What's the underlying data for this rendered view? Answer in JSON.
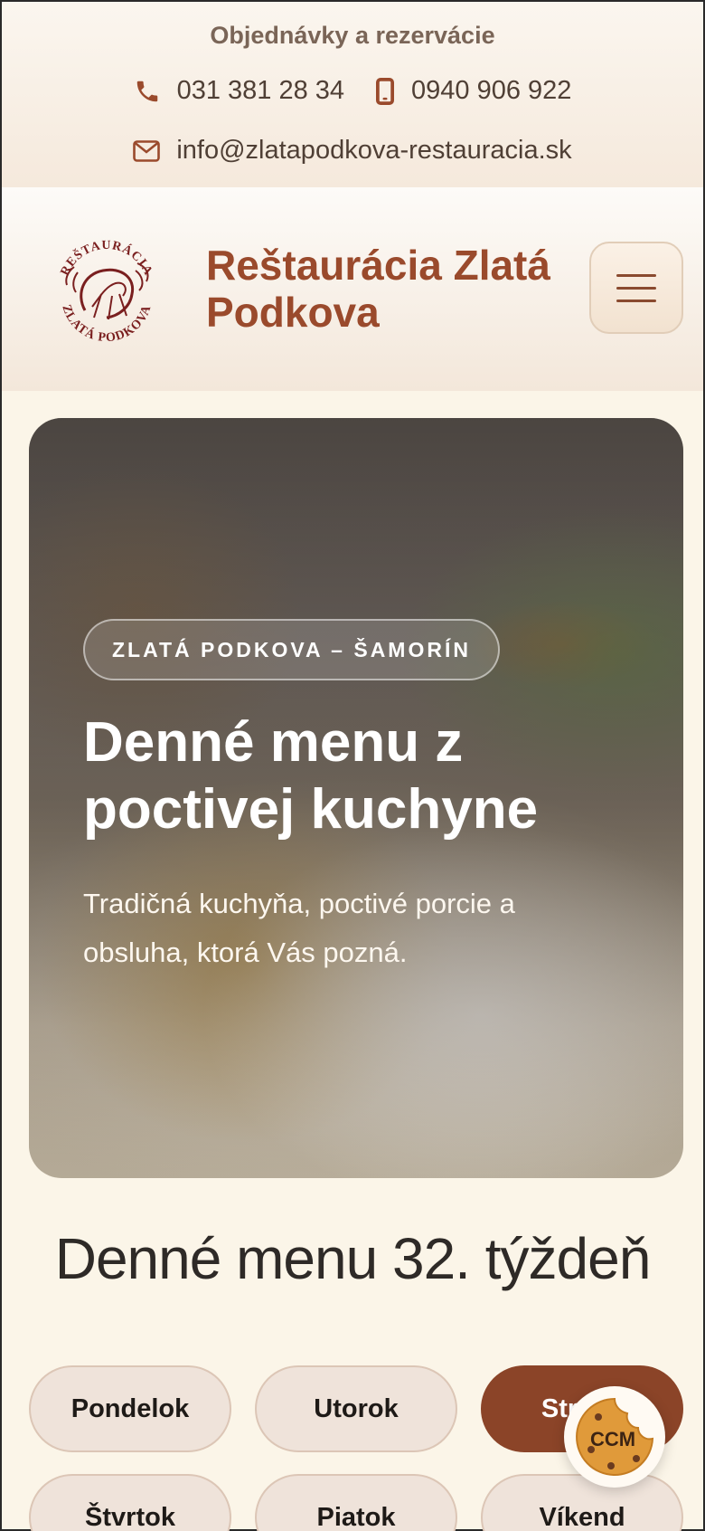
{
  "topbar": {
    "title": "Objednávky a rezervácie",
    "phone": "031 381 28 34",
    "mobile": "0940 906 922",
    "email": "info@zlatapodkova-restauracia.sk"
  },
  "header": {
    "brand": "Reštaurácia Zlatá Podkova",
    "logo_text_top": "REŠTAURÁCIA",
    "logo_text_bottom": "ZLATÁ PODKOVA"
  },
  "hero": {
    "badge": "ZLATÁ PODKOVA – ŠAMORÍN",
    "title": "Denné menu z poctivej kuchyne",
    "subtitle": "Tradičná kuchyňa, poctivé porcie a obsluha, ktorá Vás pozná."
  },
  "menu": {
    "heading": "Denné menu 32. týždeň",
    "days": [
      "Pondelok",
      "Utorok",
      "Streda",
      "Štvrtok",
      "Piatok",
      "Víkend"
    ],
    "active_day": "Streda"
  },
  "cookie_badge": {
    "label": "CCM"
  },
  "colors": {
    "accent": "#8b4428",
    "brand_text": "#9a4a2c",
    "pill_bg": "#efe3da",
    "page_bg": "#fbf5e8"
  }
}
